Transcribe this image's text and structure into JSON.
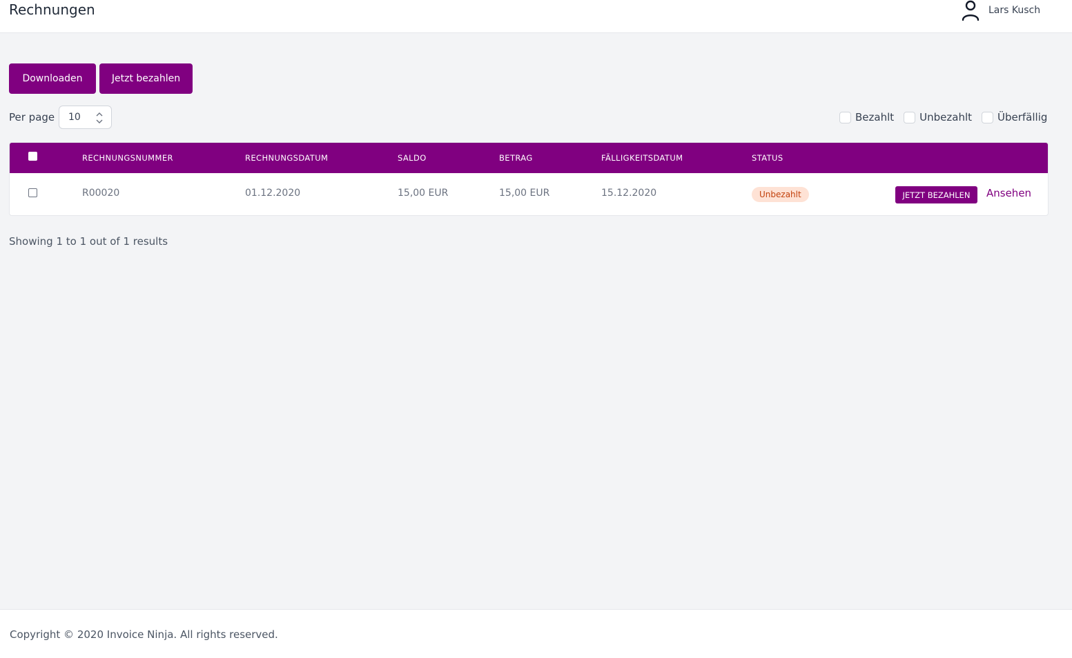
{
  "header": {
    "title": "Rechnungen",
    "user_name": "Lars Kusch",
    "user_icon": "user-icon"
  },
  "toolbar": {
    "download_label": "Downloaden",
    "pay_label": "Jetzt bezahlen"
  },
  "perpage": {
    "label": "Per page",
    "value": "10"
  },
  "filters": [
    {
      "label": "Bezahlt",
      "checked": false
    },
    {
      "label": "Unbezahlt",
      "checked": false
    },
    {
      "label": "Überfällig",
      "checked": false
    }
  ],
  "table": {
    "columns": [
      "Rechnungsnummer",
      "Rechnungsdatum",
      "Saldo",
      "Betrag",
      "Fälligkeitsdatum",
      "Status"
    ],
    "rows": [
      {
        "number": "R00020",
        "date": "01.12.2020",
        "balance": "15,00 EUR",
        "amount": "15,00 EUR",
        "due_date": "15.12.2020",
        "status": "Unbezahlt",
        "pay_action": "Jetzt bezahlen",
        "view_action": "Ansehen"
      }
    ]
  },
  "pagination": {
    "summary": "Showing 1 to 1 out of 1 results"
  },
  "footer": {
    "copyright": "Copyright © 2020 Invoice Ninja. All rights reserved."
  },
  "colors": {
    "accent": "#800080",
    "background": "#f3f4f6",
    "status_unpaid_bg": "#fee2d5",
    "status_unpaid_text": "#c2410c"
  }
}
